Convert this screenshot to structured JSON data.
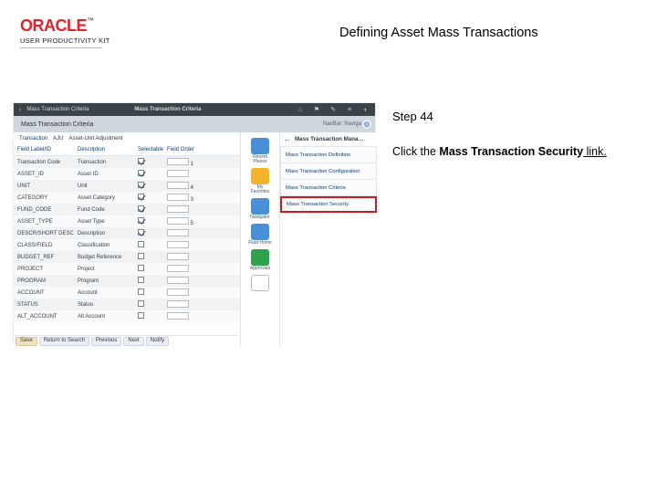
{
  "brand": {
    "name": "ORACLE",
    "tm": "™",
    "subtitle": "USER PRODUCTIVITY KIT"
  },
  "doc_title": "Defining Asset Mass Transactions",
  "step_label": "Step 44",
  "instruction": {
    "pre": "Click the ",
    "bold": "Mass Transaction Security",
    "post": " link."
  },
  "shot": {
    "topbar": {
      "back": "‹",
      "crumb": "Mass Transaction Criteria",
      "section": "Mass Transaction Criteria",
      "icons": {
        "home": "⌂",
        "flag": "⚑",
        "wrench": "✎",
        "menu": "≡",
        "user": "◐"
      }
    },
    "subband": {
      "title": "Mass Transaction Criteria",
      "nav_label": "NavBar: Navigator"
    },
    "toolbar": {
      "trans_label": "Transaction",
      "trans_value": "AJU",
      "trans_desc": "Asset-Unit Adjustment"
    },
    "columns": [
      "Field Label/ID",
      "Description",
      "Selectable",
      "Field Order",
      ""
    ],
    "rows": [
      {
        "id": "Transaction Code",
        "desc": "Transaction",
        "sel": true,
        "ord": "1"
      },
      {
        "id": "ASSET_ID",
        "desc": "Asset ID",
        "sel": true,
        "ord": ""
      },
      {
        "id": "UNIT",
        "desc": "Unit",
        "sel": true,
        "ord": "4"
      },
      {
        "id": "CATEGORY",
        "desc": "Asset Category",
        "sel": true,
        "ord": "3"
      },
      {
        "id": "FUND_CODE",
        "desc": "Fund Code",
        "sel": true,
        "ord": ""
      },
      {
        "id": "ASSET_TYPE",
        "desc": "Asset Type",
        "sel": true,
        "ord": "5"
      },
      {
        "id": "DESCR/SHORT DESC",
        "desc": "Description",
        "sel": true,
        "ord": ""
      },
      {
        "id": "CLASS/FIELD",
        "desc": "Classification",
        "sel": false,
        "ord": ""
      },
      {
        "id": "BUDGET_REF",
        "desc": "Budget Reference",
        "sel": false,
        "ord": ""
      },
      {
        "id": "PROJECT",
        "desc": "Project",
        "sel": false,
        "ord": ""
      },
      {
        "id": "PROGRAM",
        "desc": "Program",
        "sel": false,
        "ord": ""
      },
      {
        "id": "ACCOUNT",
        "desc": "Account",
        "sel": false,
        "ord": ""
      },
      {
        "id": "STATUS",
        "desc": "Status",
        "sel": false,
        "ord": ""
      },
      {
        "id": "ALT_ACCOUNT",
        "desc": "Alt Account",
        "sel": false,
        "ord": ""
      }
    ],
    "footer_tabs": [
      "Save",
      "Return to Search",
      "Previous",
      "Next",
      "Notify"
    ],
    "nav_tiles": [
      {
        "label": "Recent Places",
        "cls": "ic-blue"
      },
      {
        "label": "My Favorites",
        "cls": "ic-star"
      },
      {
        "label": "Navigator",
        "cls": "ic-doc"
      },
      {
        "label": "Fluid Home",
        "cls": "ic-grid"
      },
      {
        "label": "Approvals",
        "cls": "ic-stamp"
      },
      {
        "label": "",
        "cls": "ic-clip"
      }
    ],
    "menu": {
      "header": "Mass Transaction Mana…",
      "items": [
        {
          "label": "Mass Transaction Definition",
          "hl": false
        },
        {
          "label": "Mass Transaction Configuration",
          "hl": false
        },
        {
          "label": "Mass Transaction Criteria",
          "hl": false
        },
        {
          "label": "Mass Transaction Security",
          "hl": true
        }
      ]
    }
  }
}
